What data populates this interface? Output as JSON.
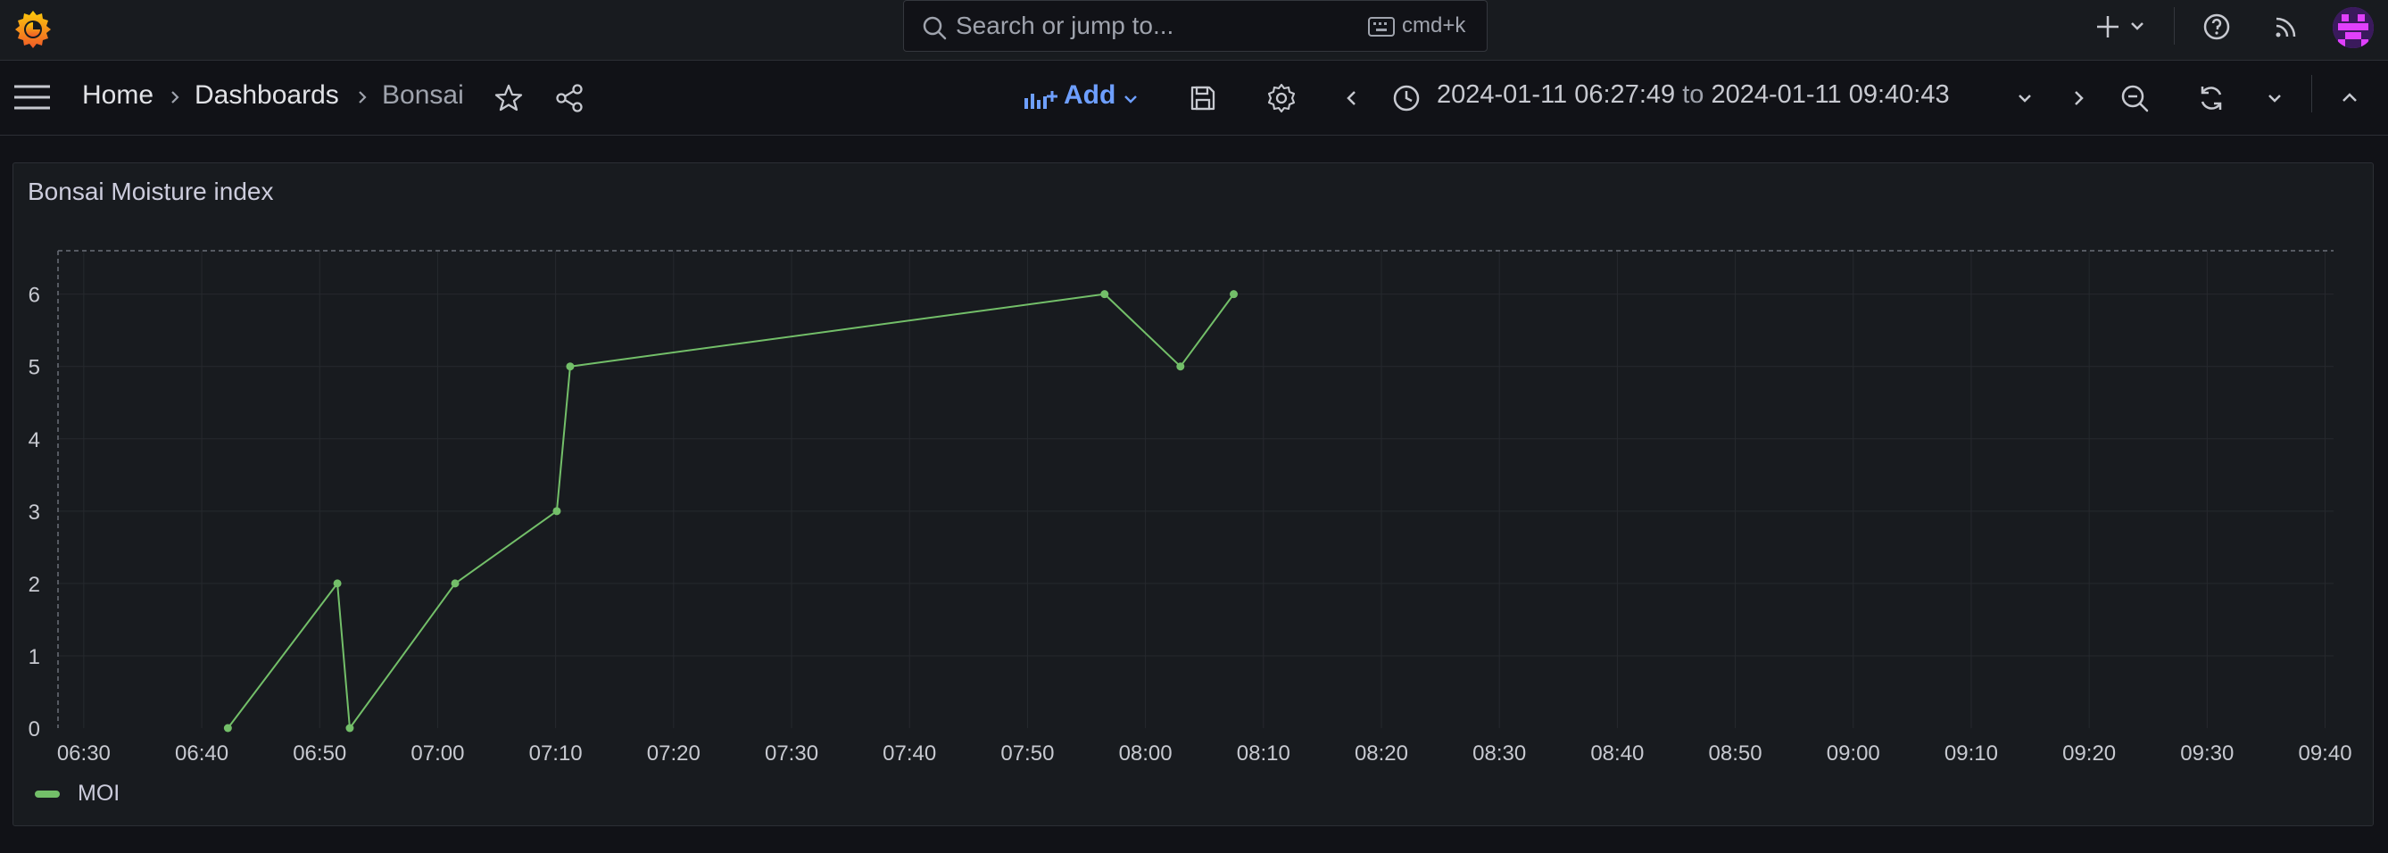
{
  "search": {
    "placeholder": "Search or jump to...",
    "shortcut": "cmd+k"
  },
  "breadcrumb": {
    "home": "Home",
    "dashboards": "Dashboards",
    "current": "Bonsai"
  },
  "toolbar": {
    "add_label": "Add",
    "time_from": "2024-01-11 06:27:49",
    "time_to_word": "to",
    "time_to": "2024-01-11 09:40:43"
  },
  "colors": {
    "series": "#73bf69",
    "accent": "#6e9fff",
    "background": "#111217",
    "panel": "#181b1f"
  },
  "icons": [
    "grafana-logo-icon",
    "search-icon",
    "keyboard-icon",
    "plus-icon",
    "help-icon",
    "rss-icon",
    "menu-icon",
    "star-icon",
    "share-icon",
    "add-panel-icon",
    "save-icon",
    "gear-icon",
    "chevron-left-icon",
    "clock-icon",
    "chevron-down-icon",
    "chevron-right-icon",
    "zoom-out-icon",
    "refresh-icon",
    "chevron-up-icon"
  ],
  "panel": {
    "title": "Bonsai Moisture index"
  },
  "chart_data": {
    "type": "line",
    "title": "Bonsai Moisture index",
    "xlabel": "",
    "ylabel": "",
    "x_ticks": [
      "06:30",
      "06:40",
      "06:50",
      "07:00",
      "07:10",
      "07:20",
      "07:30",
      "07:40",
      "07:50",
      "08:00",
      "08:10",
      "08:20",
      "08:30",
      "08:40",
      "08:50",
      "09:00",
      "09:10",
      "09:20",
      "09:30",
      "09:40"
    ],
    "y_ticks": [
      "0",
      "1",
      "2",
      "3",
      "4",
      "5",
      "6"
    ],
    "xlim": [
      "06:27:49",
      "09:40:43"
    ],
    "ylim": [
      0,
      6.6
    ],
    "grid": true,
    "legend": "bottom-left",
    "series": [
      {
        "name": "MOI",
        "color": "#73bf69",
        "points": [
          {
            "x": "06:42:13",
            "y": 0
          },
          {
            "x": "06:51:30",
            "y": 2
          },
          {
            "x": "06:52:33",
            "y": 0
          },
          {
            "x": "07:01:29",
            "y": 2
          },
          {
            "x": "07:10:06",
            "y": 3
          },
          {
            "x": "07:11:14",
            "y": 5
          },
          {
            "x": "07:56:32",
            "y": 6
          },
          {
            "x": "08:02:58",
            "y": 5
          },
          {
            "x": "08:07:29",
            "y": 6
          }
        ]
      }
    ]
  }
}
